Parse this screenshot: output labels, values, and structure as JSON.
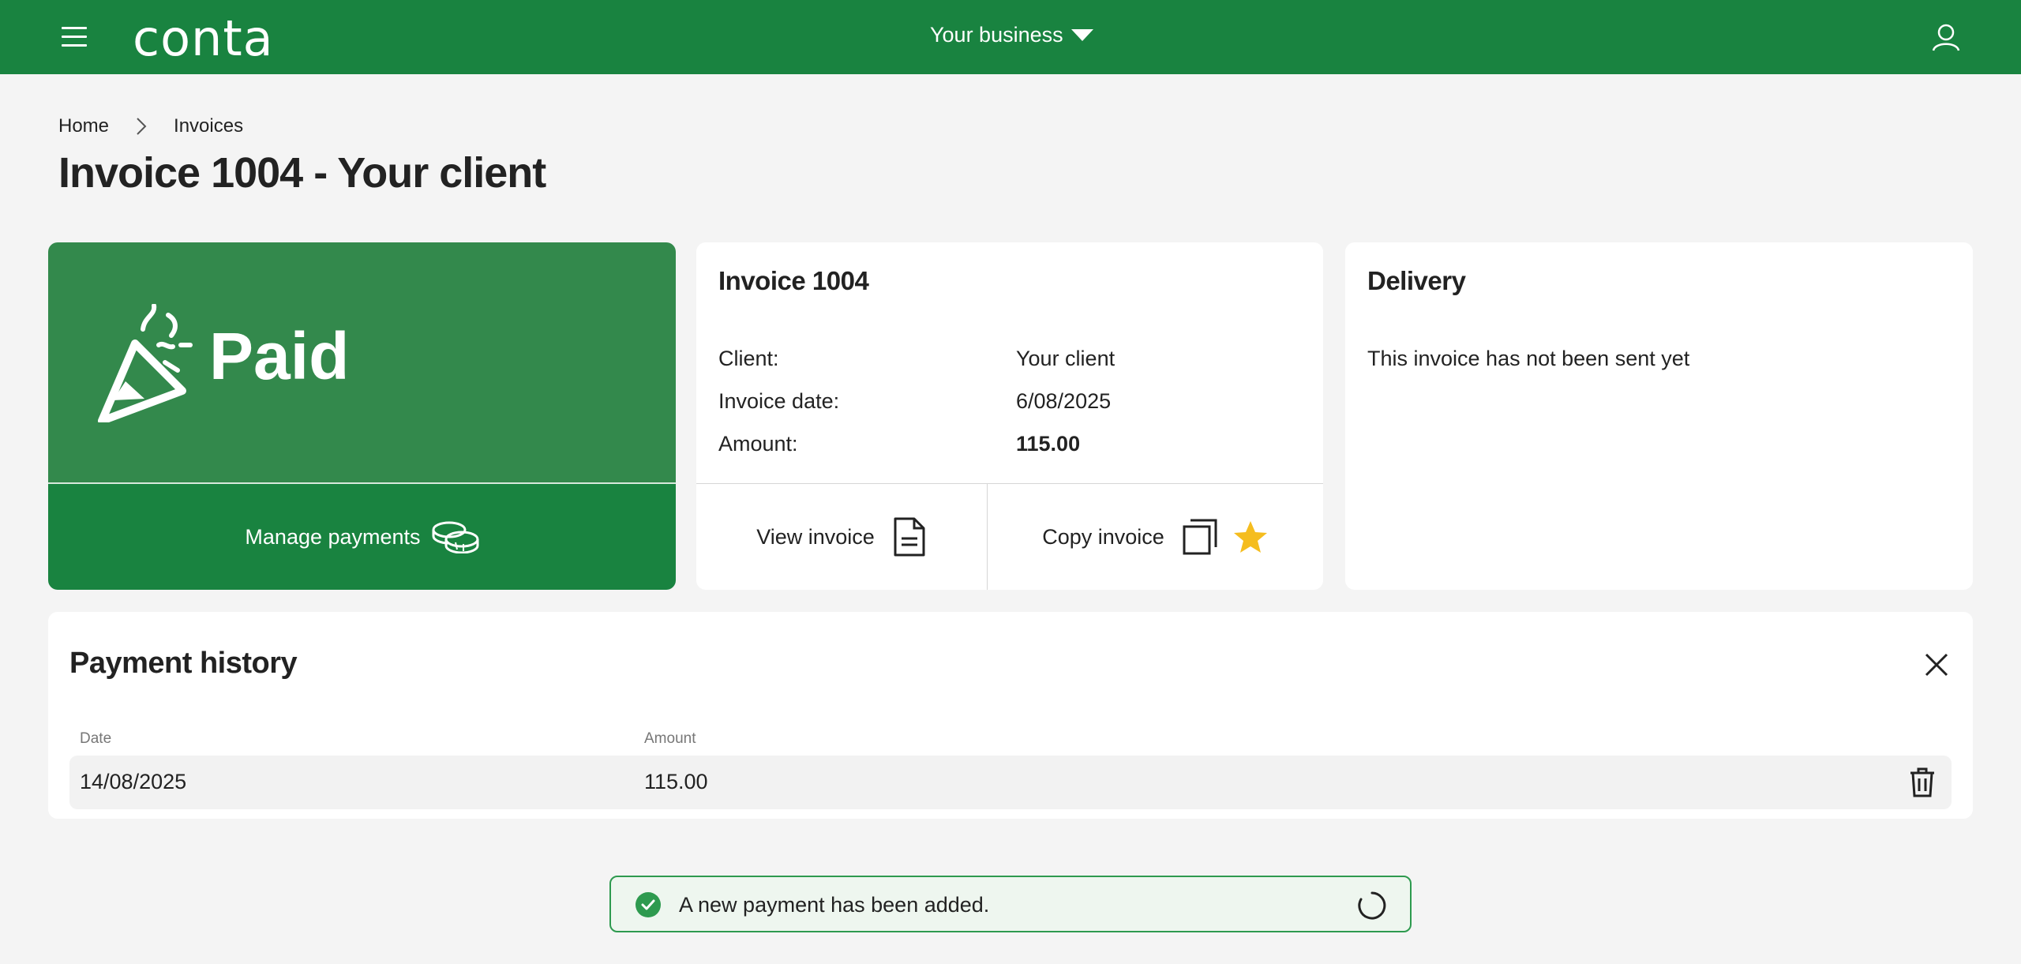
{
  "header": {
    "logo": "conta",
    "business_selector": "Your business",
    "colors": {
      "brand": "#198340"
    }
  },
  "breadcrumb": {
    "home": "Home",
    "current": "Invoices"
  },
  "page": {
    "title": "Invoice 1004 - Your client"
  },
  "status_card": {
    "status": "Paid",
    "manage_payments": "Manage payments",
    "icons": [
      "party-popper-icon",
      "coins-icon"
    ]
  },
  "invoice_card": {
    "title": "Invoice 1004",
    "rows": [
      {
        "label": "Client:",
        "value": "Your client"
      },
      {
        "label": "Invoice date:",
        "value": "6/08/2025"
      },
      {
        "label": "Amount:",
        "value": "115.00"
      }
    ],
    "view_invoice": "View invoice",
    "copy_invoice": "Copy invoice",
    "icons": [
      "document-icon",
      "copy-icon",
      "star-icon"
    ],
    "star_color": "#f5bd1f"
  },
  "delivery_card": {
    "title": "Delivery",
    "message": "This invoice has not been sent yet"
  },
  "payment_history": {
    "title": "Payment history",
    "columns": [
      "Date",
      "Amount"
    ],
    "rows": [
      {
        "date": "14/08/2025",
        "amount": "115.00"
      }
    ]
  },
  "toast": {
    "message": "A new payment has been added.",
    "color": "#2e9a4f"
  }
}
